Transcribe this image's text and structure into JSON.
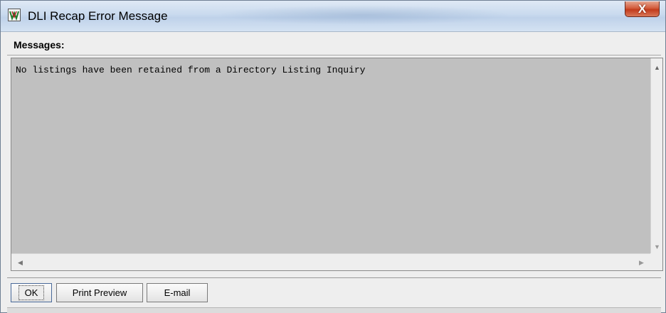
{
  "window": {
    "title": "DLI Recap Error Message",
    "close_label": "X",
    "icon": "app-logo-icon"
  },
  "messages": {
    "label": "Messages:",
    "text": "No listings have been retained from a Directory Listing Inquiry"
  },
  "scrollbars": {
    "up_arrow": "▲",
    "down_arrow": "▼",
    "left_arrow": "◀",
    "right_arrow": "▶"
  },
  "buttons": {
    "ok": "OK",
    "print_preview": "Print Preview",
    "email": "E-mail"
  },
  "colors": {
    "text_area_bg": "#c0c0c0",
    "close_button": "#c8472a"
  }
}
